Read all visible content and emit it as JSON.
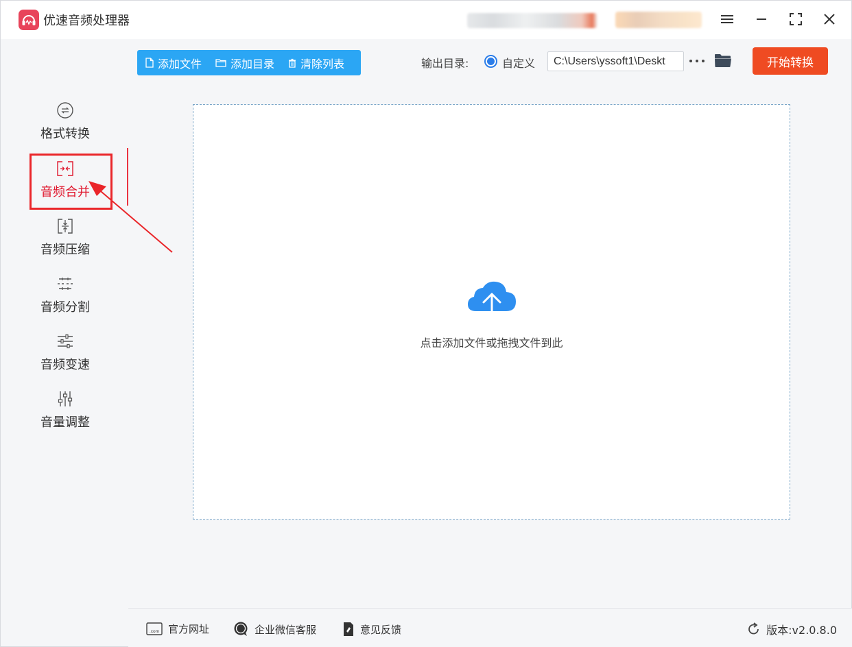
{
  "app": {
    "title": "优速音频处理器"
  },
  "toolbar": {
    "add_file": "添加文件",
    "add_folder": "添加目录",
    "clear_list": "清除列表",
    "output_label": "输出目录:",
    "custom_option": "自定义",
    "output_path": "C:\\Users\\yssoft1\\Deskt",
    "start_button": "开始转换"
  },
  "sidebar": {
    "items": [
      {
        "label": "格式转换",
        "icon": "format-convert-icon"
      },
      {
        "label": "音频合并",
        "icon": "audio-merge-icon",
        "active": true
      },
      {
        "label": "音频压缩",
        "icon": "audio-compress-icon"
      },
      {
        "label": "音频分割",
        "icon": "audio-split-icon"
      },
      {
        "label": "音频变速",
        "icon": "audio-speed-icon"
      },
      {
        "label": "音量调整",
        "icon": "volume-adjust-icon"
      }
    ]
  },
  "main": {
    "drop_hint": "点击添加文件或拖拽文件到此"
  },
  "footer": {
    "website": "官方网址",
    "wechat_service": "企业微信客服",
    "feedback": "意见反馈",
    "version": "版本:v2.0.8.0"
  },
  "colors": {
    "accent_blue": "#2ba6f4",
    "start_red": "#ef4b22",
    "active_red": "#e0182e",
    "annotation_red": "#ea2529"
  }
}
